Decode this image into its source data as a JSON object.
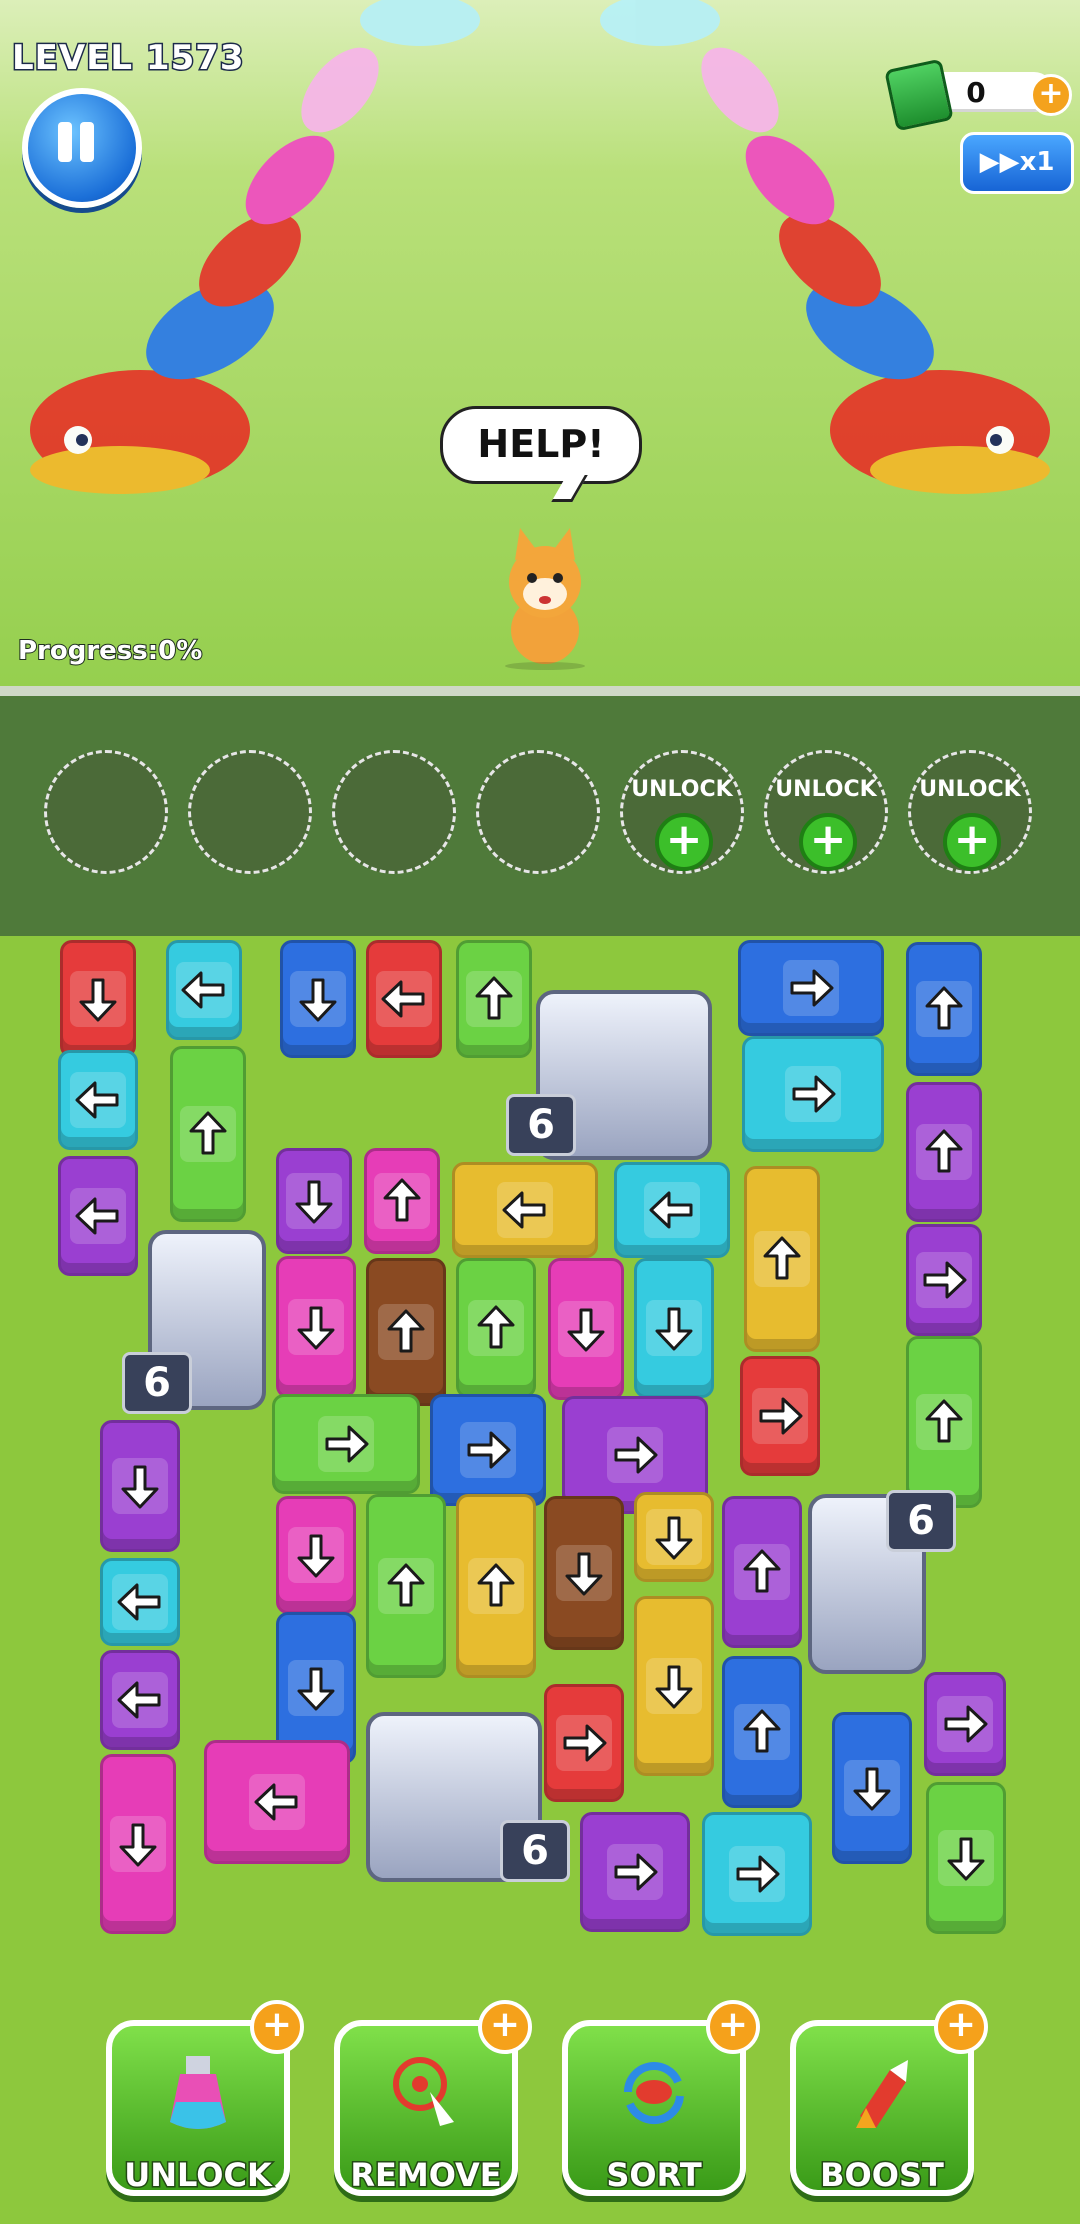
{
  "hud": {
    "level": "LEVEL 1573",
    "currency_value": "0",
    "speed_label": "x1",
    "progress": "Progress:0%"
  },
  "scene": {
    "speech": "HELP!"
  },
  "tray": {
    "unlock_label": "UNLOCK",
    "slots": [
      "empty",
      "empty",
      "empty",
      "empty",
      "locked",
      "locked",
      "locked"
    ]
  },
  "board": {
    "tunnel_capacity": "6",
    "colors": {
      "red": "#e53b3b",
      "cyan": "#35cbe0",
      "blue": "#2d6fe0",
      "green": "#6bd244",
      "purple": "#9a3fd1",
      "pink": "#e63db7",
      "yellow": "#e7bc2f",
      "brown": "#8a4a22"
    }
  },
  "toolbar": {
    "unlock": "UNLOCK",
    "remove": "REMOVE",
    "sort": "SORT",
    "boost": "BOOST"
  }
}
